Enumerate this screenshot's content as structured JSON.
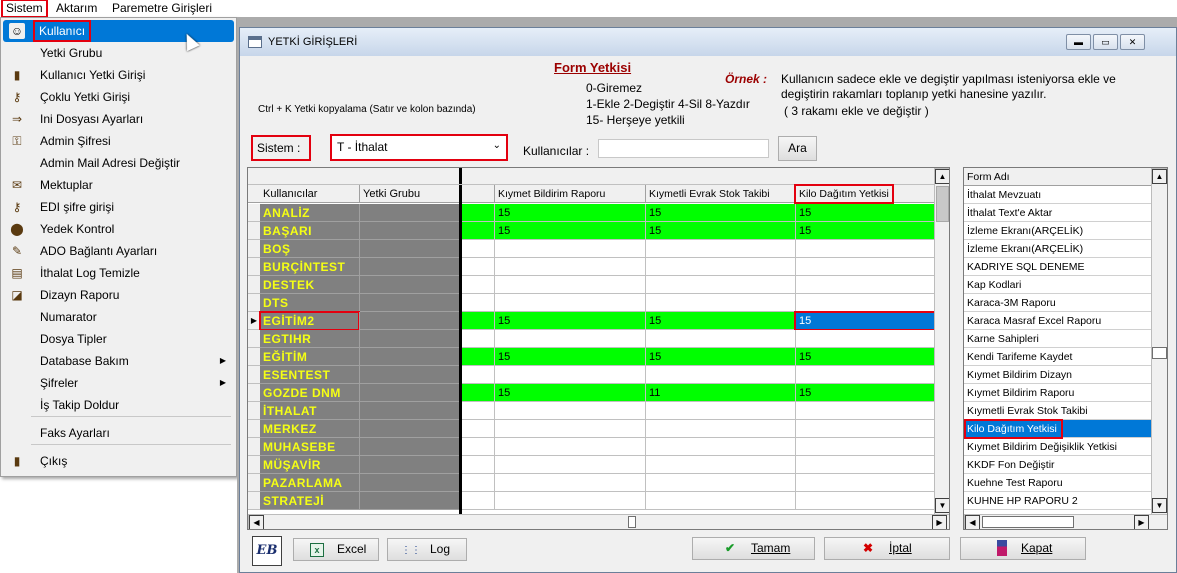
{
  "menubar": [
    "Sistem",
    "Aktarım",
    "Paremetre Girişleri"
  ],
  "sistem_menu": [
    {
      "label": "Kullanıcı",
      "icon": "user-face-icon",
      "glyph": "☺",
      "selected": true
    },
    {
      "label": "Yetki Grubu",
      "icon": "",
      "glyph": ""
    },
    {
      "label": "Kullanıcı Yetki Girişi",
      "icon": "user-key-icon",
      "glyph": "▮"
    },
    {
      "label": "Çoklu Yetki Girişi",
      "icon": "keys-icon",
      "glyph": "⚷"
    },
    {
      "label": "Ini Dosyası Ayarları",
      "icon": "ini-file-icon",
      "glyph": "⇒"
    },
    {
      "label": "Admin Şifresi",
      "icon": "key-icon",
      "glyph": "⚿"
    },
    {
      "label": "Admin Mail Adresi Değiştir",
      "icon": "",
      "glyph": ""
    },
    {
      "label": "Mektuplar",
      "icon": "letters-icon",
      "glyph": "✉"
    },
    {
      "label": "EDI şifre girişi",
      "icon": "edi-keys-icon",
      "glyph": "⚷"
    },
    {
      "label": "Yedek Kontrol",
      "icon": "backup-icon",
      "glyph": "⬤"
    },
    {
      "label": "ADO Bağlantı Ayarları",
      "icon": "connection-icon",
      "glyph": "✎"
    },
    {
      "label": "İthalat Log Temizle",
      "icon": "log-clean-icon",
      "glyph": "▤"
    },
    {
      "label": "Dizayn Raporu",
      "icon": "design-report-icon",
      "glyph": "◪"
    },
    {
      "label": "Numarator",
      "icon": "",
      "glyph": ""
    },
    {
      "label": "Dosya Tipler",
      "icon": "",
      "glyph": ""
    },
    {
      "label": "Database Bakım",
      "icon": "",
      "glyph": "",
      "submenu": true
    },
    {
      "label": "Şifreler",
      "icon": "",
      "glyph": "",
      "submenu": true
    },
    {
      "label": "İş Takip Doldur",
      "icon": "",
      "glyph": ""
    },
    {
      "label": "Faks Ayarları",
      "icon": "",
      "glyph": ""
    },
    {
      "label": "Çıkış",
      "icon": "exit-icon",
      "glyph": "▮"
    }
  ],
  "window": {
    "title": "YETKİ GİRİŞLERİ",
    "heading": "Form Yetkisi",
    "legend": [
      "0-Giremez",
      "1-Ekle  2-Degiştir  4-Sil  8-Yazdır",
      "15- Herşeye yetkili"
    ],
    "copy_hint": "Ctrl + K Yetki kopyalama (Satır ve kolon bazında)",
    "example_label": "Örnek :",
    "example_text": "Kullanıcın sadece ekle ve degiştir yapılması isteniyorsa  ekle ve degiştirin rakamları toplanıp yetki hanesine yazılır.",
    "example_note": "( 3 rakamı ekle ve değiştir )",
    "sistem_label": "Sistem :",
    "sistem_value": "T - İthalat",
    "users_label": "Kullanıcılar :",
    "users_value": "",
    "search_button": "Ara"
  },
  "grid": {
    "fixed_headers": [
      "Kullanıcılar",
      "Yetki Grubu"
    ],
    "columns": [
      "Kıymet Bildirim Raporu",
      "Kıymetli Evrak Stok Takibi",
      "Kilo Dağıtım Yetkisi"
    ],
    "rows": [
      {
        "user": "ANALİZ",
        "values": [
          "15",
          "15",
          "15"
        ],
        "green": true
      },
      {
        "user": "BAŞARI",
        "values": [
          "15",
          "15",
          "15"
        ],
        "green": true
      },
      {
        "user": "BOŞ",
        "values": [
          "",
          "",
          ""
        ],
        "green": false
      },
      {
        "user": "BURÇİNTEST",
        "values": [
          "",
          "",
          ""
        ],
        "green": false
      },
      {
        "user": "DESTEK",
        "values": [
          "",
          "",
          ""
        ],
        "green": false
      },
      {
        "user": "DTS",
        "values": [
          "",
          "",
          ""
        ],
        "green": false
      },
      {
        "user": "EGİTİM2",
        "values": [
          "15",
          "15",
          "15"
        ],
        "green": true,
        "current": true
      },
      {
        "user": "EGTIHR",
        "values": [
          "",
          "",
          ""
        ],
        "green": false
      },
      {
        "user": "EĞİTİM",
        "values": [
          "15",
          "15",
          "15"
        ],
        "green": true
      },
      {
        "user": "ESENTEST",
        "values": [
          "",
          "",
          ""
        ],
        "green": false
      },
      {
        "user": "GOZDE DNM",
        "values": [
          "15",
          "11",
          "15"
        ],
        "green": true
      },
      {
        "user": "İTHALAT",
        "values": [
          "",
          "",
          ""
        ],
        "green": false
      },
      {
        "user": "MERKEZ",
        "values": [
          "",
          "",
          ""
        ],
        "green": false
      },
      {
        "user": "MUHASEBE",
        "values": [
          "",
          "",
          ""
        ],
        "green": false
      },
      {
        "user": "MÜŞAVİR",
        "values": [
          "",
          "",
          ""
        ],
        "green": false
      },
      {
        "user": "PAZARLAMA",
        "values": [
          "",
          "",
          ""
        ],
        "green": false
      },
      {
        "user": "STRATEJİ",
        "values": [
          "",
          "",
          ""
        ],
        "green": false
      }
    ]
  },
  "forms": {
    "header": "Form Adı",
    "items": [
      "İthalat Mevzuatı",
      "İthalat Text'e Aktar",
      "İzleme Ekranı(ARÇELİK)",
      "İzleme Ekranı(ARÇELİK)",
      "KADRIYE SQL DENEME",
      "Kap Kodlari",
      "Karaca-3M Raporu",
      "Karaca Masraf Excel Raporu",
      "Karne Sahipleri",
      "Kendi Tarifeme Kaydet",
      "Kıymet Bildirim Dizayn",
      "Kıymet Bildirim Raporu",
      "Kıymetli Evrak Stok Takibi",
      "Kilo Dağıtım Yetkisi",
      "Kıymet Bildirim Değişiklik Yetkisi",
      "KKDF Fon Değiştir",
      "Kuehne Test Raporu",
      "KUHNE HP RAPORU 2"
    ],
    "selected_index": 13
  },
  "buttons": {
    "logo": "EB",
    "excel": "Excel",
    "log": "Log",
    "ok": "Tamam",
    "cancel": "İptal",
    "close": "Kapat"
  },
  "colors": {
    "highlight": "#0078d7",
    "green": "#00ff00",
    "red_marker": "#e3000f",
    "user_cell": "#808080",
    "user_text": "#f5ff14"
  }
}
